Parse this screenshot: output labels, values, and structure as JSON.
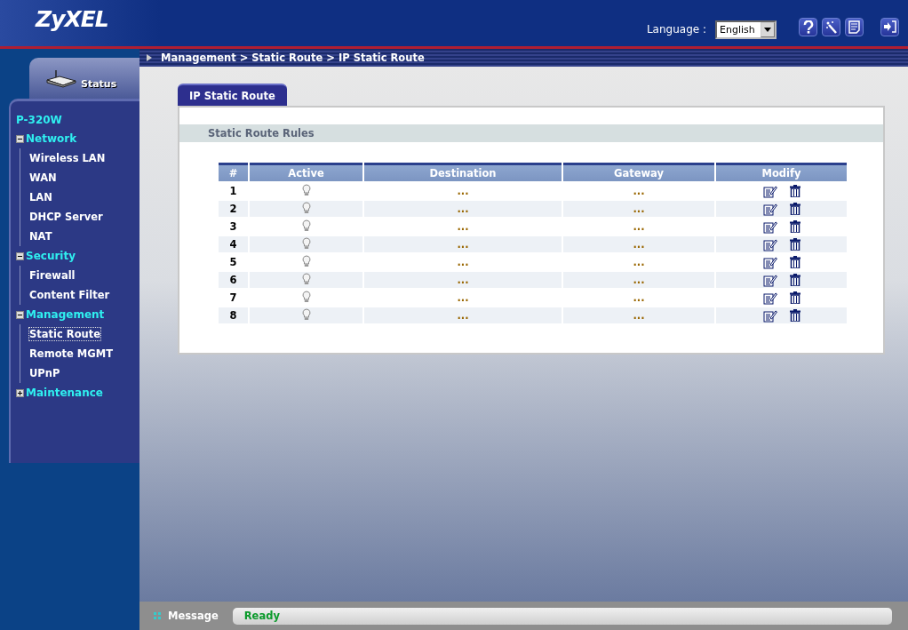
{
  "header": {
    "logo": "ZyXEL",
    "language_label": "Language :",
    "language": "English"
  },
  "sidebar": {
    "status_tab": "Status",
    "device": "P-320W",
    "items": [
      {
        "label": "Network",
        "expanded": true,
        "children": [
          {
            "label": "Wireless LAN",
            "selected": false
          },
          {
            "label": "WAN",
            "selected": false
          },
          {
            "label": "LAN",
            "selected": false
          },
          {
            "label": "DHCP Server",
            "selected": false
          },
          {
            "label": "NAT",
            "selected": false
          }
        ]
      },
      {
        "label": "Security",
        "expanded": true,
        "children": [
          {
            "label": "Firewall",
            "selected": false
          },
          {
            "label": "Content Filter",
            "selected": false
          }
        ]
      },
      {
        "label": "Management",
        "expanded": true,
        "children": [
          {
            "label": "Static Route",
            "selected": true
          },
          {
            "label": "Remote MGMT",
            "selected": false
          },
          {
            "label": "UPnP",
            "selected": false
          }
        ]
      },
      {
        "label": "Maintenance",
        "expanded": false
      }
    ]
  },
  "breadcrumb": "Management > Static Route > IP Static Route",
  "tabs": [
    {
      "label": "IP Static Route",
      "selected": true
    }
  ],
  "section_title": "Static Route Rules",
  "table": {
    "columns": [
      "#",
      "Active",
      "Destination",
      "Gateway",
      "Modify"
    ],
    "rows": [
      {
        "number": "1",
        "active": false,
        "destination": "...",
        "gateway": "..."
      },
      {
        "number": "2",
        "active": false,
        "destination": "...",
        "gateway": "..."
      },
      {
        "number": "3",
        "active": false,
        "destination": "...",
        "gateway": "..."
      },
      {
        "number": "4",
        "active": false,
        "destination": "...",
        "gateway": "..."
      },
      {
        "number": "5",
        "active": false,
        "destination": "...",
        "gateway": "..."
      },
      {
        "number": "6",
        "active": false,
        "destination": "...",
        "gateway": "..."
      },
      {
        "number": "7",
        "active": false,
        "destination": "...",
        "gateway": "..."
      },
      {
        "number": "8",
        "active": false,
        "destination": "...",
        "gateway": "..."
      }
    ]
  },
  "status_bar": {
    "label": "Message",
    "text": "Ready"
  }
}
